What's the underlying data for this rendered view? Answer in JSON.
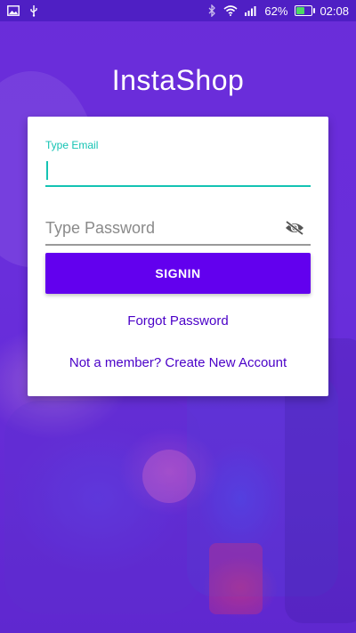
{
  "colors": {
    "accent": "#6200ee",
    "teal": "#14c3b3",
    "link": "#4a00c8",
    "status_bar": "#4f1fc4",
    "battery_fill": "#4cd964"
  },
  "status_bar": {
    "left_icons": [
      "image-icon",
      "usb-icon"
    ],
    "right_icons": [
      "bluetooth-icon",
      "wifi-icon",
      "signal-icon",
      "battery-icon"
    ],
    "battery_percent": "62%",
    "battery_level": 0.62,
    "time": "02:08"
  },
  "app": {
    "title": "InstaShop"
  },
  "login": {
    "email": {
      "label": "Type Email",
      "value": ""
    },
    "password": {
      "placeholder": "Type Password",
      "value": "",
      "toggle_icon": "eye-off-icon"
    },
    "signin_label": "SIGNIN",
    "forgot_label": "Forgot Password",
    "create_account_label": "Not a member? Create New Account"
  }
}
